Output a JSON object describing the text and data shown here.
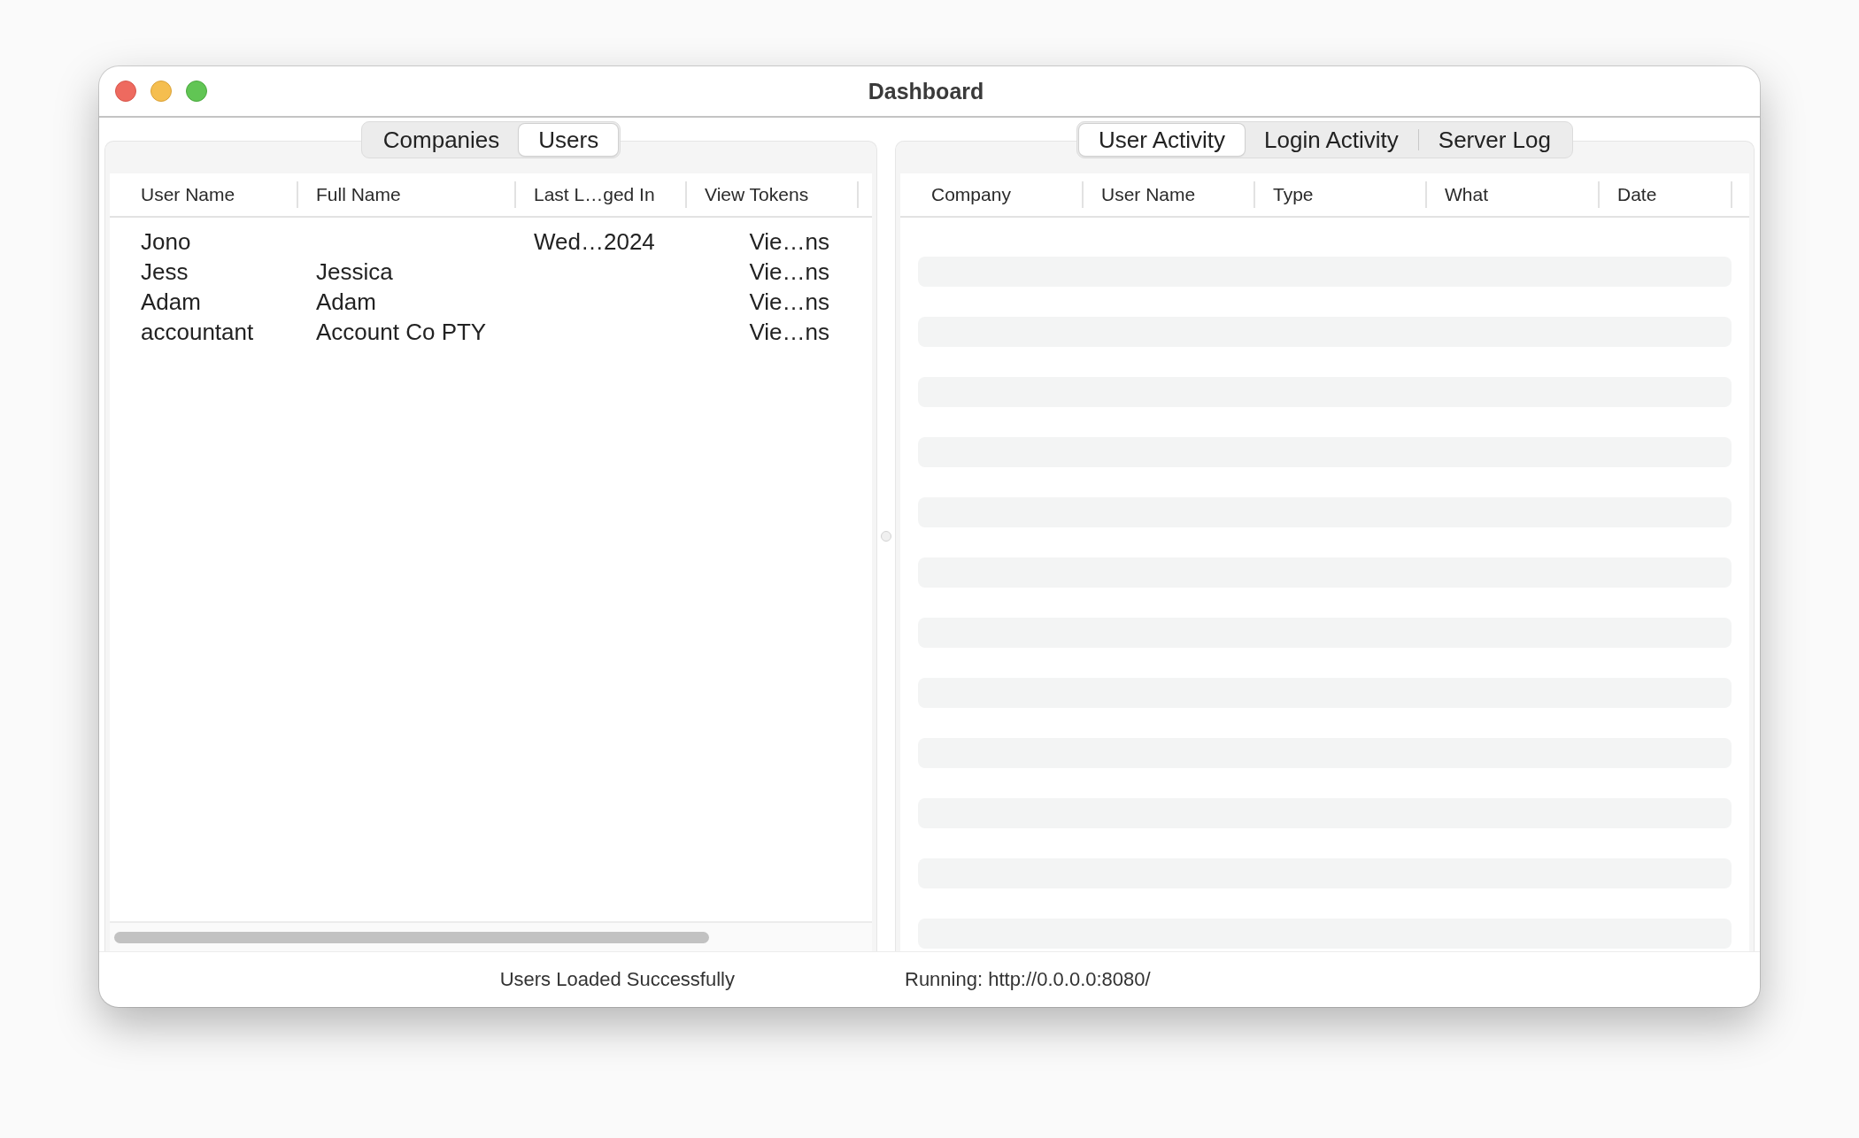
{
  "window": {
    "title": "Dashboard"
  },
  "left_panel": {
    "tabs": [
      {
        "label": "Companies",
        "selected": false
      },
      {
        "label": "Users",
        "selected": true
      }
    ],
    "table": {
      "columns": [
        "User Name",
        "Full Name",
        "Last L…ged In",
        "View Tokens"
      ],
      "rows": [
        {
          "user_name": "Jono",
          "last_logged_in": "Wed…2024",
          "view_tokens": "Vie…ns"
        },
        {
          "user_name": "Jess",
          "full_name": "Jessica",
          "view_tokens": "Vie…ns"
        },
        {
          "user_name": "Adam",
          "full_name": "Adam",
          "view_tokens": "Vie…ns"
        },
        {
          "user_name": "accountant",
          "full_name": "Account Co PTY",
          "view_tokens": "Vie…ns"
        }
      ]
    }
  },
  "right_panel": {
    "tabs": [
      {
        "label": "User Activity",
        "selected": true
      },
      {
        "label": "Login Activity",
        "selected": false
      },
      {
        "label": "Server Log",
        "selected": false
      }
    ],
    "table": {
      "columns": [
        "Company",
        "User Name",
        "Type",
        "What",
        "Date"
      ]
    }
  },
  "status_bar": [
    "Users Loaded Successfully",
    "Running: http://0.0.0.0:8080/"
  ]
}
